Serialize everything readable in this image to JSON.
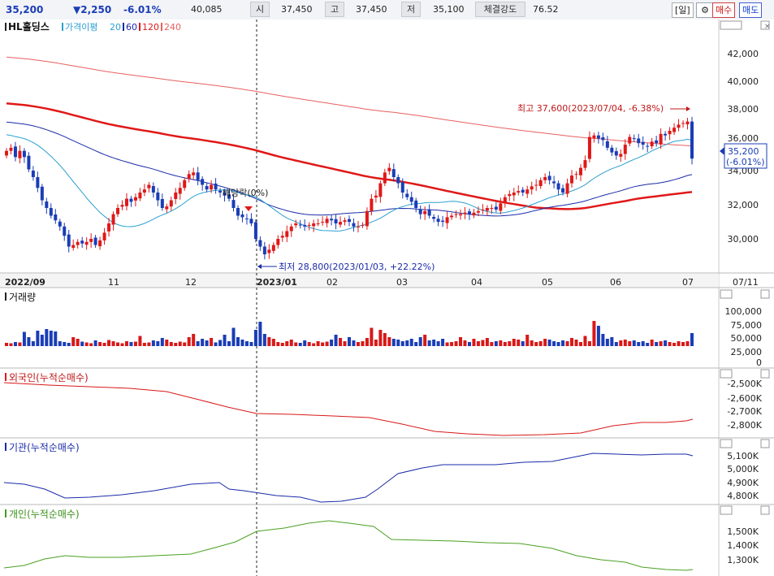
{
  "header": {
    "price": "35,200",
    "change": "▼2,250",
    "change_pct": "-6.01%",
    "volume": "40,085",
    "open_label": "시",
    "open": "37,450",
    "high_label": "고",
    "high": "37,450",
    "low_label": "저",
    "low": "35,100",
    "strength_label": "체결강도",
    "strength": "76.52",
    "period_button": "[일]",
    "buy_button": "매수",
    "sell_button": "매도"
  },
  "panes": {
    "price": {
      "title": "HL홀딩스",
      "legend_ma": "가격이평",
      "legend_periods": [
        "20",
        "60",
        "120",
        "240"
      ],
      "legend_colors": [
        "#2aa0d0",
        "#1a2aa8",
        "#e01818",
        "#e03838"
      ],
      "price_tag": "35,200",
      "price_tag_pct": "(-6.01%)",
      "high_annotation": "최고 37,600(2023/07/04, -6.38%)",
      "low_annotation": "최저 28,800(2023/01/03, +22.22%)",
      "dividend_annotation": "배당락(0%)",
      "y_ticks": [
        "42,000",
        "40,000",
        "38,000",
        "36,000",
        "34,000",
        "32,000",
        "30,000"
      ],
      "x_ticks": [
        "2022/09",
        "11",
        "12",
        "2023/01",
        "02",
        "03",
        "04",
        "05",
        "06",
        "07",
        "07/11"
      ]
    },
    "volume": {
      "title": "거래량",
      "y_ticks": [
        "100,000",
        "75,000",
        "50,000",
        "25,000",
        "0"
      ]
    },
    "foreign": {
      "title": "외국인(누적순매수)",
      "y_ticks": [
        "-2,500K",
        "-2,600K",
        "-2,700K",
        "-2,800K"
      ]
    },
    "institution": {
      "title": "기관(누적순매수)",
      "y_ticks": [
        "5,100K",
        "5,000K",
        "4,900K",
        "4,800K"
      ]
    },
    "individual": {
      "title": "개인(누적순매수)",
      "y_ticks": [
        "1,500K",
        "1,400K",
        "1,300K"
      ]
    }
  },
  "chart_data": {
    "type": "candlestick",
    "symbol": "HL홀딩스",
    "ylim": [
      28000,
      43500
    ],
    "volume_ylim": [
      0,
      125000
    ],
    "close": [
      35700,
      35900,
      35300,
      35700,
      35300,
      34500,
      34000,
      33300,
      32500,
      32000,
      31500,
      31200,
      30800,
      30200,
      29500,
      29600,
      29800,
      29700,
      29800,
      30000,
      29600,
      29900,
      30400,
      31000,
      31600,
      32000,
      32200,
      32600,
      32400,
      32700,
      33000,
      33200,
      33500,
      33000,
      32500,
      32000,
      32100,
      32500,
      33000,
      33300,
      33800,
      34200,
      34300,
      33800,
      33500,
      33200,
      33500,
      33200,
      33000,
      32800,
      32600,
      32000,
      31500,
      31400,
      31300,
      31000,
      30000,
      29500,
      29000,
      29300,
      29600,
      30000,
      30200,
      30500,
      30800,
      31000,
      30900,
      30800,
      30900,
      31000,
      31000,
      31100,
      31300,
      31200,
      31000,
      31100,
      31200,
      31100,
      30800,
      30800,
      30900,
      31800,
      32600,
      32800,
      33600,
      34300,
      34600,
      34000,
      33600,
      33000,
      32700,
      32400,
      32000,
      31600,
      31800,
      31500,
      31300,
      31100,
      31100,
      31400,
      31500,
      31600,
      31600,
      31700,
      31600,
      31700,
      31800,
      31900,
      32000,
      32000,
      31900,
      32300,
      32700,
      32900,
      33000,
      33100,
      33000,
      33200,
      33400,
      33500,
      33800,
      34000,
      33800,
      33600,
      33200,
      33000,
      33600,
      34100,
      34200,
      34600,
      35100,
      36600,
      36700,
      36500,
      36400,
      35900,
      35600,
      35400,
      35500,
      36100,
      36600,
      36500,
      36200,
      36100,
      36000,
      36300,
      36200,
      36800,
      36700,
      37000,
      37200,
      37400,
      37500,
      37600,
      35200
    ],
    "volume": [
      8,
      7,
      10,
      9,
      35,
      22,
      12,
      38,
      28,
      42,
      38,
      36,
      12,
      10,
      8,
      22,
      18,
      11,
      9,
      7,
      14,
      10,
      8,
      15,
      12,
      9,
      7,
      12,
      10,
      11,
      25,
      8,
      9,
      14,
      12,
      20,
      16,
      10,
      8,
      11,
      9,
      22,
      30,
      12,
      18,
      14,
      20,
      9,
      15,
      28,
      12,
      45,
      22,
      16,
      12,
      10,
      40,
      60,
      30,
      22,
      18,
      10,
      8,
      12,
      16,
      9,
      8,
      14,
      10,
      7,
      12,
      9,
      11,
      16,
      28,
      20,
      12,
      22,
      14,
      10,
      12,
      20,
      45,
      16,
      40,
      32,
      22,
      18,
      16,
      12,
      14,
      18,
      10,
      22,
      28,
      14,
      16,
      12,
      18,
      9,
      10,
      12,
      22,
      14,
      10,
      18,
      12,
      15,
      20,
      10,
      12,
      14,
      10,
      12,
      18,
      16,
      12,
      28,
      14,
      10,
      12,
      18,
      16,
      12,
      10,
      14,
      12,
      20,
      16,
      10,
      25,
      12,
      62,
      50,
      30,
      18,
      22,
      10,
      14,
      16,
      12,
      14,
      10,
      12,
      8,
      16,
      10,
      12,
      14,
      10,
      8,
      12,
      10,
      12,
      32
    ]
  }
}
